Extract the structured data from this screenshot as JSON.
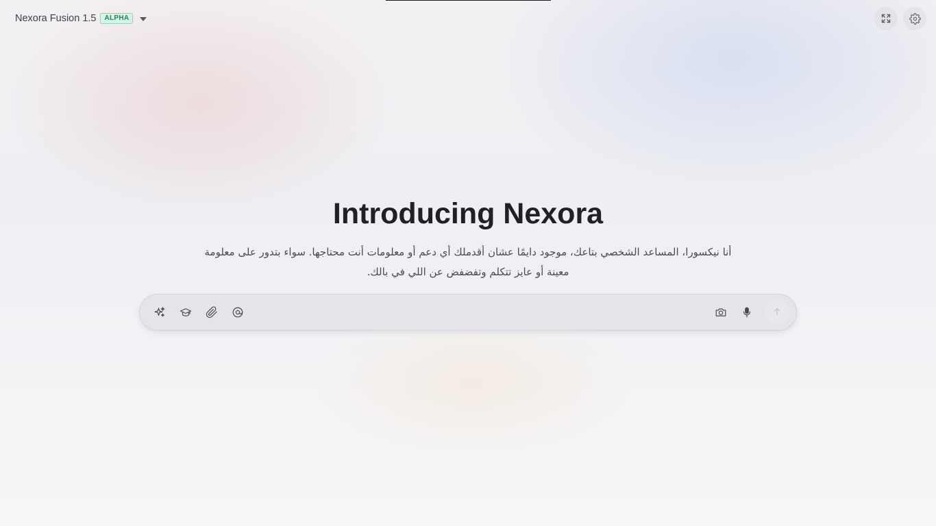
{
  "header": {
    "model_name": "Nexora Fusion 1.5",
    "model_badge": "ALPHA",
    "dropdown_icon": "chevron-down-icon",
    "fullscreen_icon": "expand-icon",
    "settings_icon": "gear-icon"
  },
  "hero": {
    "title": "Introducing Nexora",
    "description": "أنا نيكسورا، المساعد الشخصي بتاعك، موجود دايمًا عشان أقدملك أي دعم أو معلومات أنت محتاجها. سواء بتدور على معلومة معينة أو عايز تتكلم وتفضفض عن اللي في بالك."
  },
  "composer": {
    "placeholder": "",
    "value": "",
    "left_tools": [
      "sparkles-icon",
      "graduation-cap-icon",
      "paperclip-icon",
      "at-sign-icon"
    ],
    "right_tools": [
      "camera-icon",
      "microphone-icon"
    ],
    "send_icon": "arrow-up-icon"
  },
  "colors": {
    "badge_text": "#1b8a5a",
    "badge_bg": "#d9f3e6",
    "title": "#202124",
    "composer_bg": "#e4e5ea"
  }
}
